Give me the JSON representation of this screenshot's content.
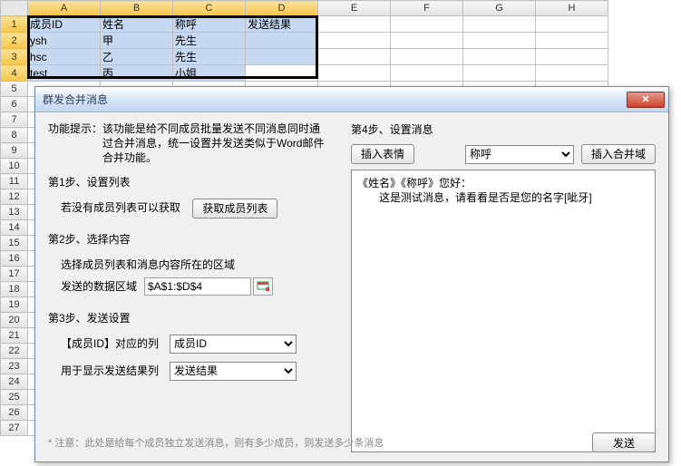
{
  "sheet": {
    "columns": [
      "A",
      "B",
      "C",
      "D",
      "E",
      "F",
      "G",
      "H"
    ],
    "rows": [
      [
        "成员ID",
        "姓名",
        "称呼",
        "发送结果",
        "",
        "",
        "",
        ""
      ],
      [
        "ysh",
        "甲",
        "先生",
        "",
        "",
        "",
        "",
        ""
      ],
      [
        "hsc",
        "乙",
        "先生",
        "",
        "",
        "",
        "",
        ""
      ],
      [
        "test",
        "丙",
        "小姐",
        "",
        "",
        "",
        "",
        ""
      ]
    ],
    "total_rows": 27
  },
  "dialog": {
    "title": "群发合并消息",
    "hint_label": "功能提示：",
    "hint_text": "该功能是给不同成员批量发送不同消息同时通过合并消息，统一设置并发送类似于Word邮件合并功能。",
    "step1": {
      "header": "第1步、设置列表",
      "text": "若没有成员列表可以获取",
      "button": "获取成员列表"
    },
    "step2": {
      "header": "第2步、选择内容",
      "desc": "选择成员列表和消息内容所在的区域",
      "range_label": "发送的数据区域",
      "range_value": "$A$1:$D$4"
    },
    "step3": {
      "header": "第3步、发送设置",
      "id_label": "【成员ID】对应的列",
      "id_value": "成员ID",
      "result_label": "用于显示发送结果列",
      "result_value": "发送结果"
    },
    "step4": {
      "header": "第4步、设置消息",
      "insert_emotion": "插入表情",
      "field_select": "称呼",
      "insert_field": "插入合并域",
      "message_line1": "《姓名》《称呼》您好：",
      "message_line2": "这是测试消息，请看看是否是您的名字[呲牙]"
    },
    "note": "* 注意：此处是给每个成员独立发送消息，则有多少成员，则发送多少条消息",
    "send": "发送"
  },
  "chart_data": {
    "type": "table",
    "columns": [
      "成员ID",
      "姓名",
      "称呼",
      "发送结果"
    ],
    "rows": [
      [
        "ysh",
        "甲",
        "先生",
        ""
      ],
      [
        "hsc",
        "乙",
        "先生",
        ""
      ],
      [
        "test",
        "丙",
        "小姐",
        ""
      ]
    ]
  }
}
